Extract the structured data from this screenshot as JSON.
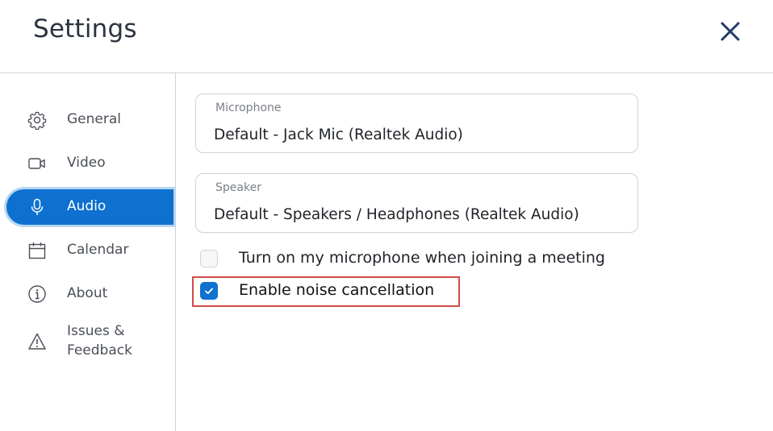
{
  "header": {
    "title": "Settings",
    "close_icon": "close-icon"
  },
  "sidebar": {
    "items": [
      {
        "label": "General",
        "icon": "gear-icon",
        "active": false
      },
      {
        "label": "Video",
        "icon": "video-camera-icon",
        "active": false
      },
      {
        "label": "Audio",
        "icon": "microphone-icon",
        "active": true
      },
      {
        "label": "Calendar",
        "icon": "calendar-icon",
        "active": false
      },
      {
        "label": "About",
        "icon": "info-icon",
        "active": false
      },
      {
        "label_line1": "Issues &",
        "label_line2": "Feedback",
        "icon": "warning-icon",
        "active": false
      }
    ]
  },
  "audio": {
    "microphone": {
      "label": "Microphone",
      "value": "Default - Jack Mic (Realtek Audio)"
    },
    "speaker": {
      "label": "Speaker",
      "value": "Default - Speakers / Headphones (Realtek Audio)"
    },
    "options": [
      {
        "label": "Turn on my microphone when joining a meeting",
        "checked": false
      },
      {
        "label": "Enable noise cancellation",
        "checked": true,
        "highlighted": true
      }
    ]
  },
  "colors": {
    "accent": "#0e71d0",
    "highlight_border": "#d04b47",
    "title_text": "#2b3340"
  }
}
